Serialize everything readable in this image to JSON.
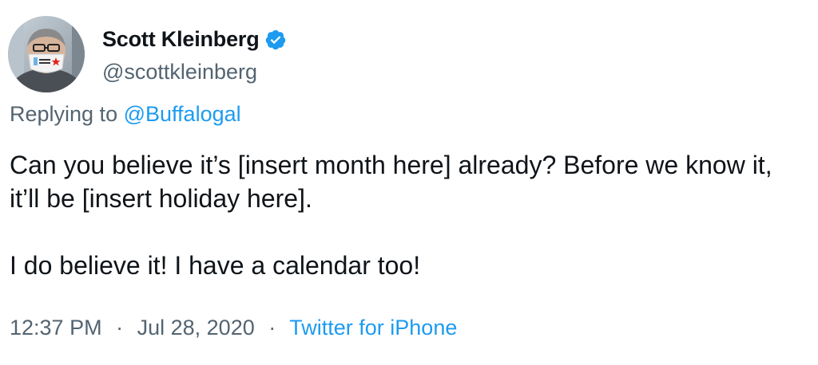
{
  "tweet": {
    "author": {
      "display_name": "Scott Kleinberg",
      "handle": "@scottkleinberg",
      "verified": true,
      "verified_color": "#1d9bf0"
    },
    "replying_prefix": "Replying to",
    "replying_to": "@Buffalogal",
    "body_lines": [
      "Can you believe it’s [insert month here] already? Before we know it, it’ll be [insert holiday here].",
      "I do believe it! I have a calendar too!"
    ],
    "time": "12:37 PM",
    "separator": "·",
    "date": "Jul 28, 2020",
    "source": "Twitter for iPhone"
  },
  "colors": {
    "text": "#0f1419",
    "secondary": "#536471",
    "link": "#1d9bf0"
  },
  "icons": {
    "avatar": "avatar-photo",
    "verified": "verified-badge-icon"
  }
}
